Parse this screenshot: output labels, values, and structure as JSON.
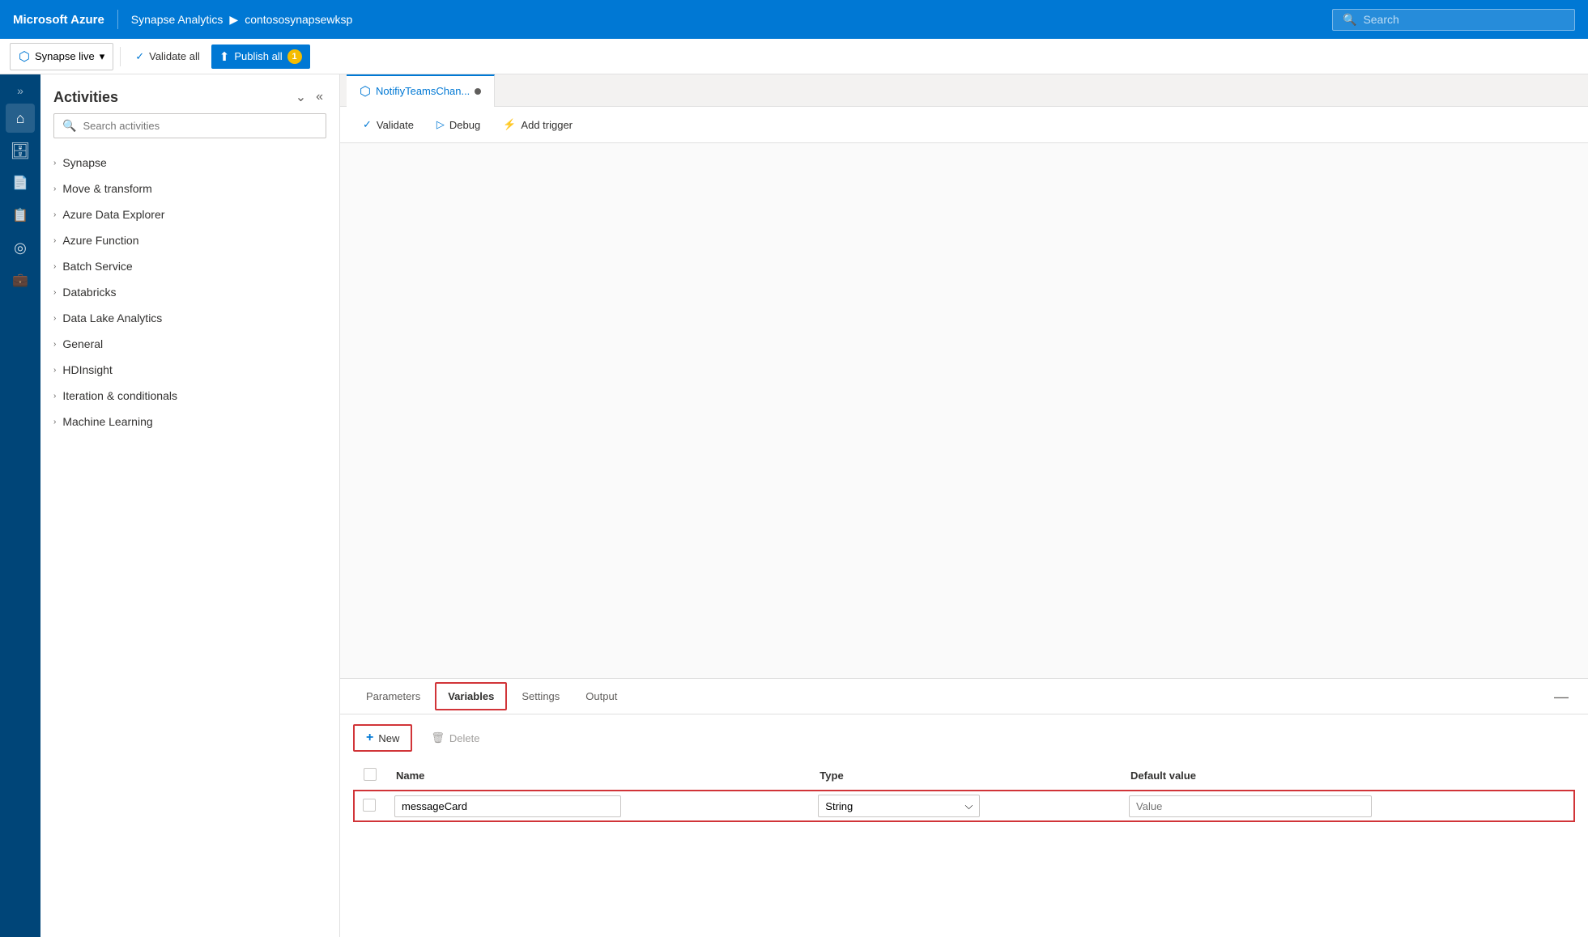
{
  "topbar": {
    "brand": "Microsoft Azure",
    "nav_service": "Synapse Analytics",
    "nav_arrow": "▶",
    "nav_workspace": "contososynapsewksp",
    "search_placeholder": "Search"
  },
  "toolbar": {
    "synapse_live": "Synapse live",
    "validate_all": "Validate all",
    "publish_all": "Publish all",
    "badge_count": "1"
  },
  "activities": {
    "title": "Activities",
    "search_placeholder": "Search activities",
    "groups": [
      {
        "label": "Synapse"
      },
      {
        "label": "Move & transform"
      },
      {
        "label": "Azure Data Explorer"
      },
      {
        "label": "Azure Function"
      },
      {
        "label": "Batch Service"
      },
      {
        "label": "Databricks"
      },
      {
        "label": "Data Lake Analytics"
      },
      {
        "label": "General"
      },
      {
        "label": "HDInsight"
      },
      {
        "label": "Iteration & conditionals"
      },
      {
        "label": "Machine Learning"
      }
    ]
  },
  "tab": {
    "name": "NotifiyTeamsChan...",
    "dot_visible": true
  },
  "pipeline_toolbar": {
    "validate": "Validate",
    "debug": "Debug",
    "add_trigger": "Add trigger"
  },
  "bottom_tabs": {
    "parameters": "Parameters",
    "variables": "Variables",
    "settings": "Settings",
    "output": "Output",
    "minimize_icon": "—"
  },
  "variables": {
    "new_label": "New",
    "delete_label": "Delete",
    "columns": [
      "Name",
      "Type",
      "Default value"
    ],
    "rows": [
      {
        "name": "messageCard",
        "type": "String",
        "default_value": "Value"
      }
    ]
  },
  "icons": {
    "home": "⌂",
    "database": "🗄",
    "documents": "📄",
    "monitor": "📊",
    "settings_circle": "⚙",
    "briefcase": "💼",
    "expand": "»",
    "collapse_panel": "«",
    "search": "🔍",
    "chevron_right": "›",
    "chevron_down": "⌵",
    "validate_check": "✓",
    "debug_play": "▷",
    "trigger_bolt": "⚡",
    "trash": "🗑",
    "plus": "+"
  }
}
